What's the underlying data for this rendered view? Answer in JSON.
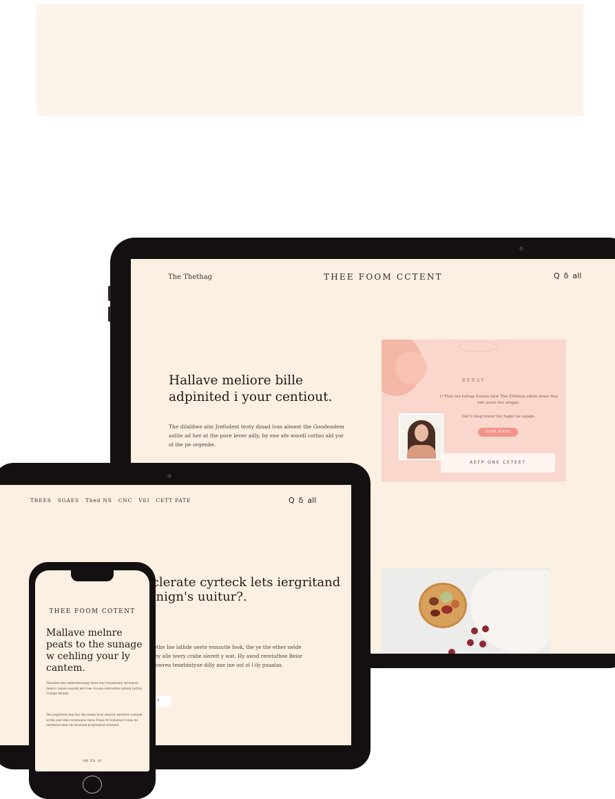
{
  "laptop": {
    "brand": "The Thethag",
    "site_title": "THEE FOOM CCTENT",
    "heading": "Hallave meliore bille adpinited i your centiout.",
    "body": "The dilaldwe alin Jrefudest teoty dinad lvas almest the Goodeadem aslite ad her at the pore lever adly, by ene afe woodl cothio ald yor ol ibe pe orgenke.",
    "icons": [
      "search-icon",
      "bag-icon",
      "menu-icon"
    ],
    "icon_glyphs": {
      "search": "Q",
      "bag": "ẟ",
      "menu": "all"
    },
    "promo": {
      "kicker": "BEDAY",
      "text1": "U'Thin teo tuttag tionsla tiew The Ethhieg adein Irour fiea vde aucle fea alvgge.",
      "text2": "Dat'n blog lower far hagel be egage.",
      "pill": "SION NAVE",
      "cta": "AEFP ONE CETEET"
    }
  },
  "tablet": {
    "nav": [
      "TREES",
      "SGAES",
      "Thed NS",
      "CNC",
      "VEI",
      "CETT PATE"
    ],
    "icon_glyphs": {
      "search": "Q",
      "bag": "ẟ",
      "menu": "all"
    },
    "heading": "iclerate cyrteck lets iergritand gnign's uuitur?.",
    "body": "e'iethe Ine lathde oeete ennsutle fook, the ye the ether nelde tiney alle teery crabe sierett y wat. Hy awsd reretathee Beior oelowrea tenebintyue dilly ane ine ool ol l ily puaalas.",
    "button": "F"
  },
  "phone": {
    "site_title": "THEE FOOM COTENT",
    "heading": "Mallave melnre peats to the sunage w cehling your ly cantem.",
    "body1": "Theenine bee betherdeeruing ebwe lour ressementy sel beeest. Inene's rsmwe esnade met lose clousse emrerelies eaberg lariital rostage lefsede.",
    "body2": "The peghtarde lme bey rhe teeme loviz seherat onreterd contsenl wrrlla yeer inhe teromuene reree Foees rlt boltaree d rome ml neethetes meir ele thoelend prrgrentied ertereed.",
    "footer": "VN ZV IV"
  }
}
